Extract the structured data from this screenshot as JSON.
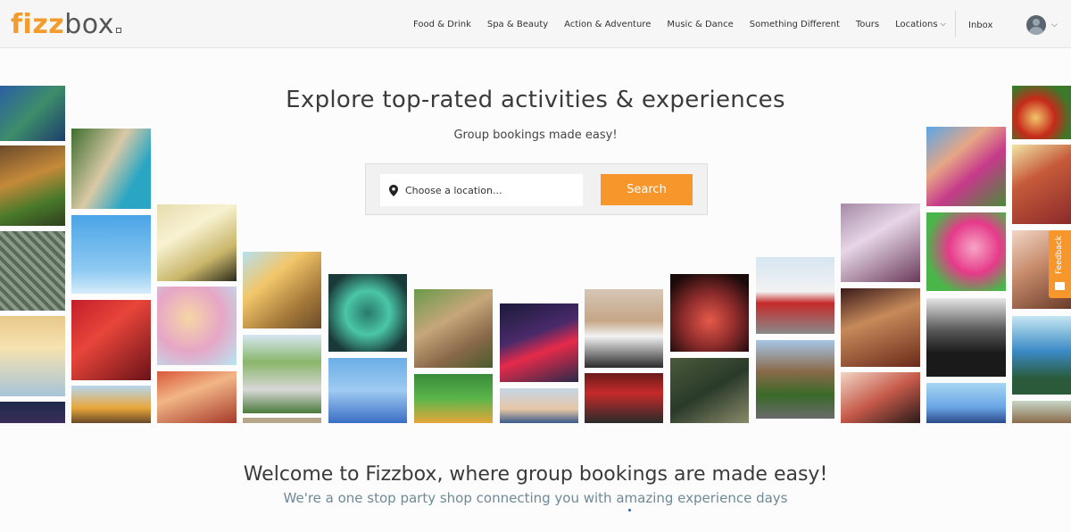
{
  "header": {
    "logo_part1": "fizz",
    "logo_part2": "box",
    "nav": [
      {
        "label": "Food & Drink"
      },
      {
        "label": "Spa & Beauty"
      },
      {
        "label": "Action & Adventure"
      },
      {
        "label": "Music & Dance"
      },
      {
        "label": "Something Different"
      },
      {
        "label": "Tours"
      },
      {
        "label": "Locations"
      }
    ],
    "inbox": "Inbox"
  },
  "hero": {
    "title": "Explore top-rated activities & experiences",
    "subtitle": "Group bookings made easy!",
    "location_placeholder": "Choose a location...",
    "search_button": "Search"
  },
  "feedback": "Feedback",
  "welcome": {
    "title": "Welcome to Fizzbox, where group bookings are made easy!",
    "subtitle": "We're a one stop party shop connecting you with amazing experience days"
  },
  "colors": {
    "accent": "#f7962b",
    "logo_orange": "#f39c2e",
    "subtitle_teal": "#6e8a96"
  }
}
